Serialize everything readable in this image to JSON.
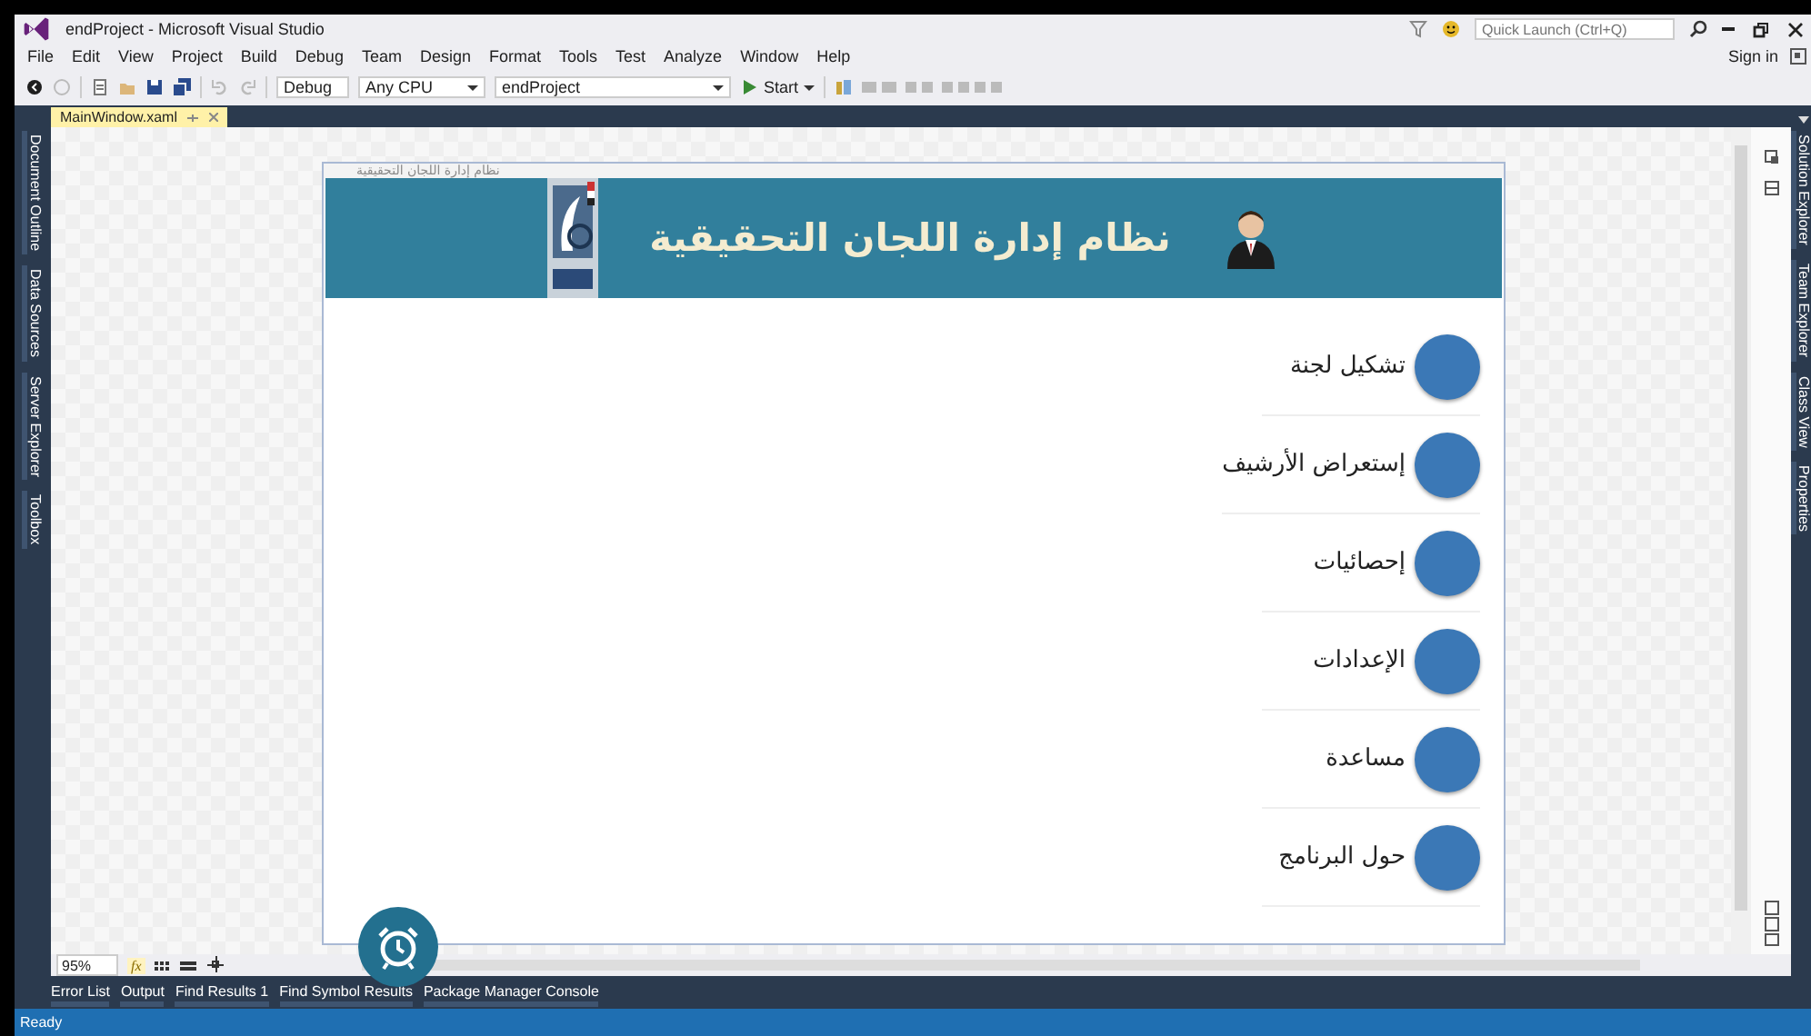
{
  "window": {
    "title": "endProject - Microsoft Visual Studio",
    "quick_launch": {
      "placeholder": "Quick Launch (Ctrl+Q)"
    },
    "sign_in": "Sign in"
  },
  "menu": [
    "File",
    "Edit",
    "View",
    "Project",
    "Build",
    "Debug",
    "Team",
    "Design",
    "Format",
    "Tools",
    "Test",
    "Analyze",
    "Window",
    "Help"
  ],
  "toolbar": {
    "configuration": "Debug",
    "platform": "Any CPU",
    "project": "endProject",
    "start": "Start"
  },
  "document_tabs": [
    {
      "label": "MainWindow.xaml",
      "selected": true
    }
  ],
  "left_tool_tabs": [
    "Document Outline",
    "Data Sources",
    "Server Explorer",
    "Toolbox"
  ],
  "right_tool_tabs": [
    "Solution Explorer",
    "Team Explorer",
    "Class View",
    "Properties"
  ],
  "designer": {
    "window_title": "نظام إدارة اللجان التحقيقية",
    "header_title": "نظام إدارة اللجان التحقيقية",
    "menu_items": [
      {
        "label": "تشكيل لجنة"
      },
      {
        "label": "إستعراض الأرشيف"
      },
      {
        "label": "إحصائيات"
      },
      {
        "label": "الإعدادات"
      },
      {
        "label": "مساعدة"
      },
      {
        "label": "حول البرنامج"
      }
    ]
  },
  "zoom": "95%",
  "formula_button": "fx",
  "bottom_tabs": [
    "Error List",
    "Output",
    "Find Results 1",
    "Find Symbol Results",
    "Package Manager Console"
  ],
  "status_bar": "Ready"
}
